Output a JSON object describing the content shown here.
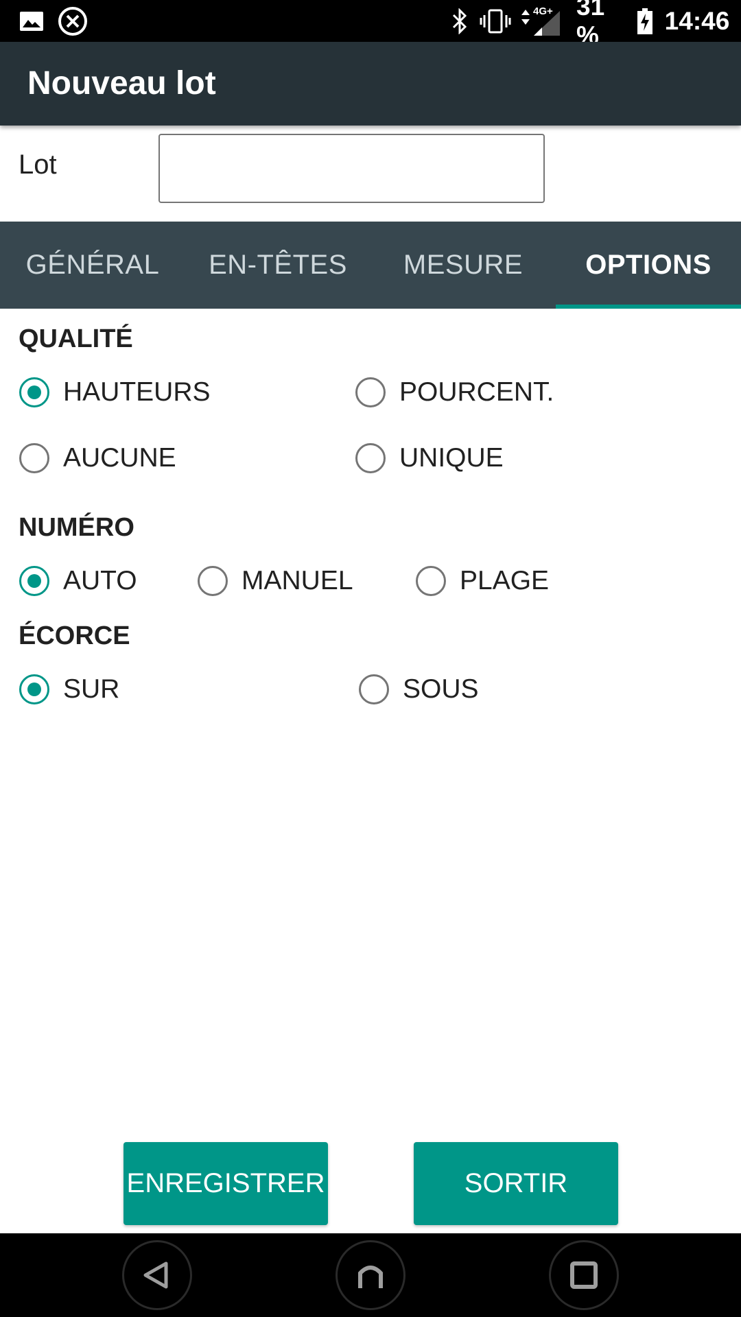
{
  "status_bar": {
    "battery": "31 %",
    "time": "14:46",
    "network": "4G+",
    "icons": [
      "image-icon",
      "close-circle-icon",
      "bluetooth-icon",
      "vibrate-icon",
      "signal-icon",
      "battery-charging-icon"
    ]
  },
  "appbar": {
    "title": "Nouveau lot"
  },
  "lot": {
    "label": "Lot",
    "value": ""
  },
  "tabs": [
    {
      "label": "GÉNÉRAL",
      "active": false
    },
    {
      "label": "EN-TÊTES",
      "active": false
    },
    {
      "label": "MESURE",
      "active": false
    },
    {
      "label": "OPTIONS",
      "active": true
    }
  ],
  "qualite": {
    "title": "QUALITÉ",
    "options": [
      {
        "label": "HAUTEURS",
        "checked": true
      },
      {
        "label": "POURCENT.",
        "checked": false
      },
      {
        "label": "AUCUNE",
        "checked": false
      },
      {
        "label": "UNIQUE",
        "checked": false
      }
    ]
  },
  "numero": {
    "title": "NUMÉRO",
    "options": [
      {
        "label": "AUTO",
        "checked": true
      },
      {
        "label": "MANUEL",
        "checked": false
      },
      {
        "label": "PLAGE",
        "checked": false
      }
    ]
  },
  "ecorce": {
    "title": "ÉCORCE",
    "options": [
      {
        "label": "SUR",
        "checked": true
      },
      {
        "label": "SOUS",
        "checked": false
      }
    ]
  },
  "buttons": {
    "save": "ENREGISTRER",
    "exit": "SORTIR"
  },
  "colors": {
    "accent": "#009688",
    "appbar": "#263238",
    "tabbar": "#37474F"
  }
}
